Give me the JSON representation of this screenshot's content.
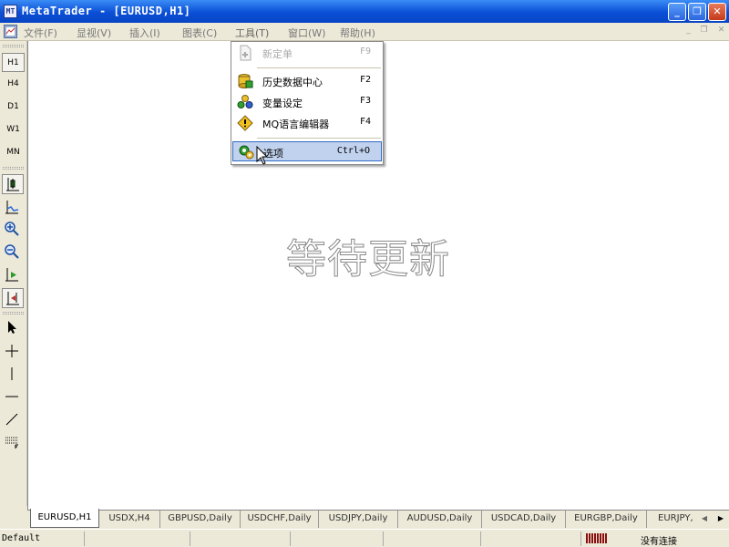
{
  "window": {
    "title": "MetaTrader - [EURUSD,H1]",
    "app_icon_text": "MT",
    "minimize": "_",
    "restore": "❐",
    "close": "✕"
  },
  "menubar": {
    "items": [
      {
        "label": "文件(F)"
      },
      {
        "label": "显视(V)"
      },
      {
        "label": "插入(I)"
      },
      {
        "label": "图表(C)"
      },
      {
        "label": "工具(T)"
      },
      {
        "label": "窗口(W)"
      },
      {
        "label": "帮助(H)"
      }
    ],
    "mdi_minimize": "_",
    "mdi_restore": "❐",
    "mdi_close": "✕"
  },
  "timeframes": [
    "H1",
    "H4",
    "D1",
    "W1",
    "MN"
  ],
  "tools_menu": [
    {
      "label": "新定单",
      "shortcut": "F9",
      "icon": "new-order-icon",
      "disabled": true
    },
    {
      "label": "历史数据中心",
      "shortcut": "F2",
      "icon": "history-center-icon"
    },
    {
      "label": "变量设定",
      "shortcut": "F3",
      "icon": "global-variables-icon"
    },
    {
      "label": "MQ语言编辑器",
      "shortcut": "F4",
      "icon": "mq-editor-icon"
    },
    {
      "label": "选项",
      "shortcut": "Ctrl+O",
      "icon": "options-icon",
      "highlighted": true
    }
  ],
  "chart": {
    "waiting_text": "等待更新"
  },
  "tabs": [
    "EURUSD,H1",
    "USDX,H4",
    "GBPUSD,Daily",
    "USDCHF,Daily",
    "USDJPY,Daily",
    "AUDUSD,Daily",
    "USDCAD,Daily",
    "EURGBP,Daily",
    "EURJPY,"
  ],
  "tab_arrows": {
    "left": "◀",
    "right": "▶"
  },
  "status": {
    "profile": "Default",
    "connection": "没有连接"
  }
}
